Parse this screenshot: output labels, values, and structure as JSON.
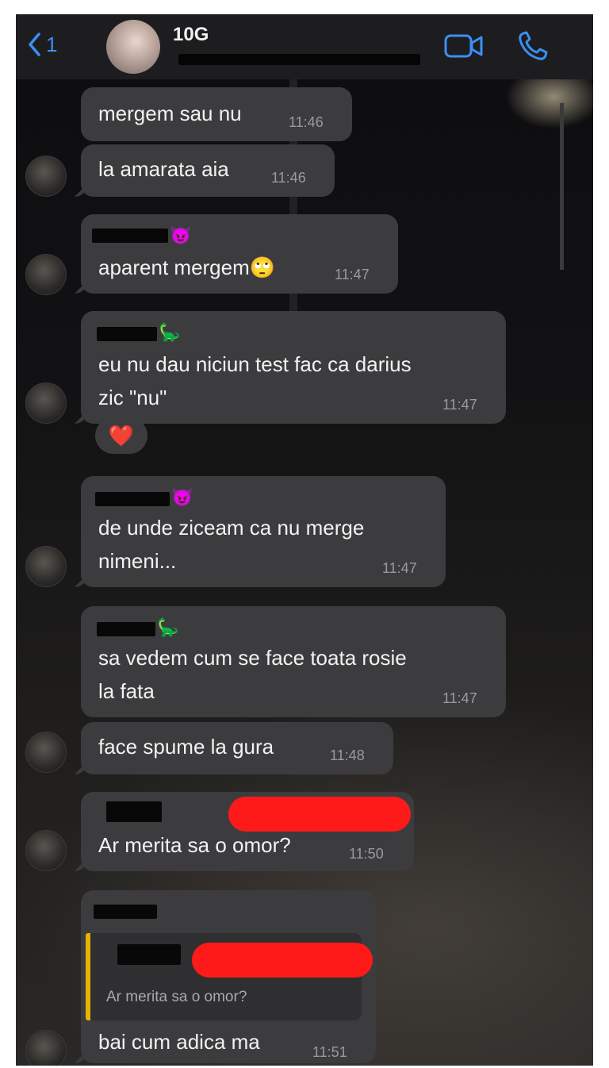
{
  "header": {
    "back_count": "1",
    "title": "10G"
  },
  "messages": [
    {
      "text": "mergem sau nu",
      "time": "11:46"
    },
    {
      "text": "la amarata aia",
      "time": "11:46"
    },
    {
      "sender_emoji": "😈",
      "text": "aparent mergem",
      "text_emoji": "🙄",
      "time": "11:47"
    },
    {
      "sender_emoji": "🦕",
      "line1": "eu nu dau niciun test fac ca darius",
      "line2": "zic \"nu\"",
      "time": "11:47",
      "reaction": "❤️"
    },
    {
      "sender_emoji": "😈",
      "line1": "de unde ziceam ca nu merge",
      "line2": "nimeni...",
      "time": "11:47"
    },
    {
      "sender_emoji": "🦕",
      "line1": "sa vedem cum se face toata rosie",
      "line2": "la fata",
      "time": "11:47"
    },
    {
      "text": "face spume la gura",
      "time": "11:48"
    },
    {
      "text": "Ar merita sa o omor?",
      "time": "11:50"
    },
    {
      "quote": "Ar merita sa o omor?",
      "text": "bai cum adica ma",
      "time": "11:51"
    }
  ],
  "colors": {
    "accent": "#3b8ff5",
    "bubble": "#3c3c3e",
    "quote_bar": "#e5b400",
    "redaction_red": "#ff1a1a"
  },
  "icons": [
    "chevron-left-icon",
    "video-call-icon",
    "phone-call-icon",
    "heart-icon"
  ]
}
